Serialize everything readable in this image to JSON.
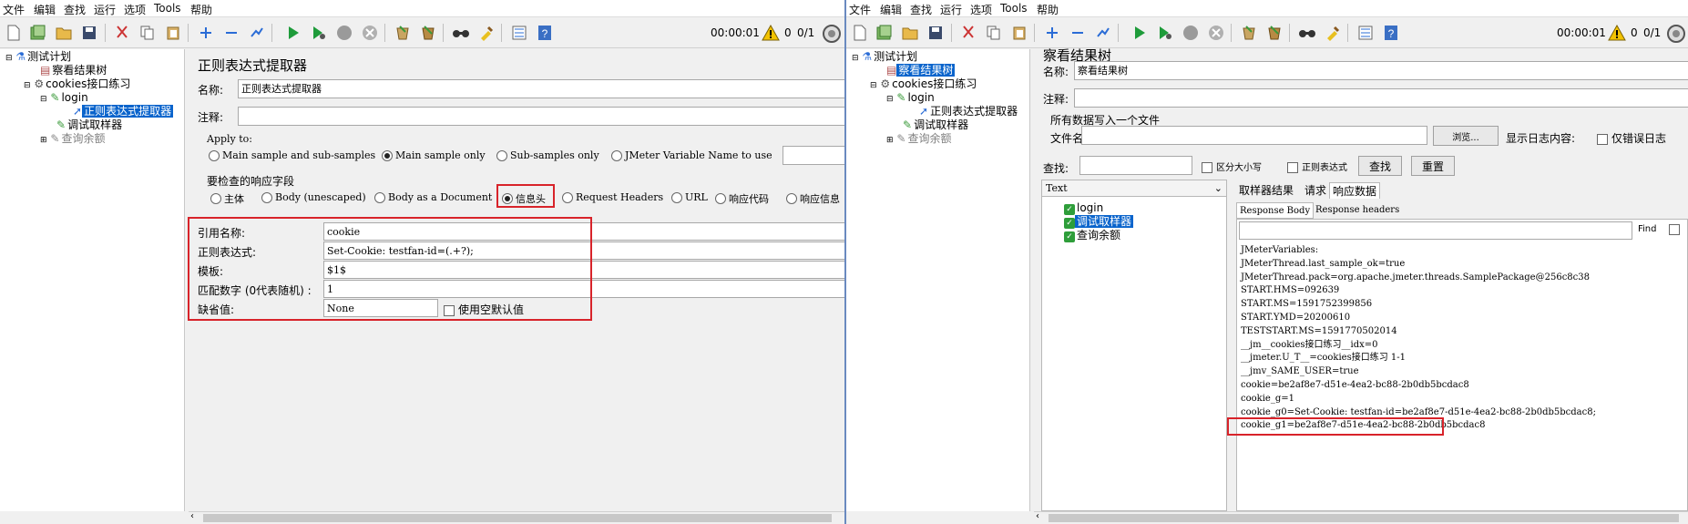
{
  "menu": [
    "文件",
    "编辑",
    "查找",
    "运行",
    "选项",
    "Tools",
    "帮助"
  ],
  "toolbar": {
    "timer": "00:00:01",
    "warn_count": "0",
    "threads": "0/1"
  },
  "left": {
    "tree": {
      "root": "测试计划",
      "view_results": "察看结果树",
      "thread_group": "cookies接口练习",
      "login": "login",
      "regex_extractor": "正则表达式提取器",
      "debug_sampler": "调试取样器",
      "query_balance": "查询余额"
    },
    "panel": {
      "title": "正则表达式提取器",
      "name_label": "名称:",
      "name_value": "正则表达式提取器",
      "comment_label": "注释:",
      "apply_to_label": "Apply to:",
      "apply_options": [
        "Main sample and sub-samples",
        "Main sample only",
        "Sub-samples only",
        "JMeter Variable Name to use"
      ],
      "field_label": "要检查的响应字段",
      "field_options": [
        "主体",
        "Body (unescaped)",
        "Body as a Document",
        "信息头",
        "Request Headers",
        "URL",
        "响应代码",
        "响应信息"
      ],
      "ref_label": "引用名称:",
      "ref_value": "cookie",
      "regex_label": "正则表达式:",
      "regex_value": "Set-Cookie: testfan-id=(.+?);",
      "template_label": "模板:",
      "template_value": "$1$",
      "match_label": "匹配数字 (0代表随机) :",
      "match_value": "1",
      "default_label": "缺省值:",
      "default_value": "None",
      "use_empty_label": "使用空默认值"
    }
  },
  "right": {
    "tree": {
      "root": "测试计划",
      "view_results": "察看结果树",
      "thread_group": "cookies接口练习",
      "login": "login",
      "regex_extractor": "正则表达式提取器",
      "debug_sampler": "调试取样器",
      "query_balance": "查询余额"
    },
    "panel": {
      "title": "察看结果树",
      "name_label": "名称:",
      "name_value": "察看结果树",
      "comment_label": "注释:",
      "write_all_label": "所有数据写入一个文件",
      "filename_label": "文件名",
      "browse_label": "浏览...",
      "log_label": "显示日志内容:",
      "errors_only_label": "仅错误日志",
      "search_label": "查找:",
      "case_label": "区分大小写",
      "regex_label": "正则表达式",
      "find_button": "查找",
      "reset_button": "重置",
      "renderer": "Text",
      "result_items": [
        "login",
        "调试取样器",
        "查询余额"
      ],
      "tabs": [
        "取样器结果",
        "请求",
        "响应数据"
      ],
      "subtabs": [
        "Response Body",
        "Response headers"
      ],
      "find_label": "Find",
      "response_lines": [
        "JMeterVariables:",
        "JMeterThread.last_sample_ok=true",
        "JMeterThread.pack=org.apache.jmeter.threads.SamplePackage@256c8c38",
        "START.HMS=092639",
        "START.MS=1591752399856",
        "START.YMD=20200610",
        "TESTSTART.MS=1591770502014",
        "__jm__cookies接口练习__idx=0",
        "__jmeter.U_T__=cookies接口练习 1-1",
        "__jmv_SAME_USER=true",
        "cookie=be2af8e7-d51e-4ea2-bc88-2b0db5bcdac8",
        "cookie_g=1",
        "cookie_g0=Set-Cookie: testfan-id=be2af8e7-d51e-4ea2-bc88-2b0db5bcdac8;",
        "cookie_g1=be2af8e7-d51e-4ea2-bc88-2b0db5bcdac8"
      ]
    }
  },
  "colors": {
    "highlight_red": "#d8232a",
    "selection_blue": "#0a64cc",
    "check_green": "#2e9e3a"
  }
}
